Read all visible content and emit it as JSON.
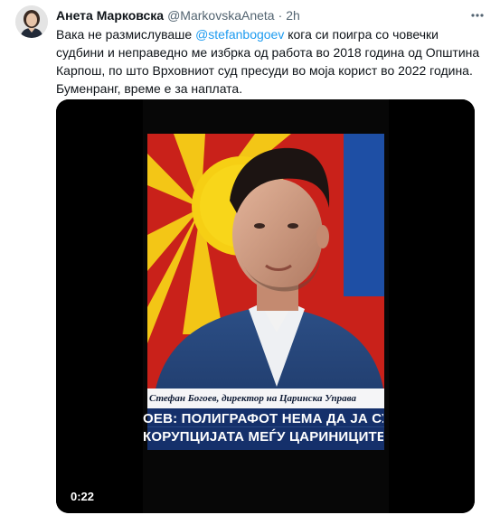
{
  "author": {
    "display_name": "Анета Марковска",
    "handle": "@MarkovskaAneta",
    "separator": "·",
    "time": "2h"
  },
  "tweet": {
    "text_prefix": "Вака не размислуваше ",
    "mention": "@stefanbogoev",
    "text_suffix": " кога си поигра со човечки судбини и неправедно ме избрка од работа во 2018 година од Општина Карпош, по што Врховниот суд пресуди во моја корист во 2022 година.\nБуменранг, време е за наплата."
  },
  "video": {
    "duration": "0:22",
    "caption_name": "Стефан Богоев, директор на Царинска Управа",
    "ticker_line_1": "ОЕВ: ПОЛИГРАФОТ НЕМА ДА ЈА СУЗБ",
    "ticker_line_2": "КОРУПЦИЈАТА МЕЃУ ЦАРИНИЦИТЕ"
  },
  "icons": {
    "more": "more-horizontal-icon"
  },
  "colors": {
    "link": "#1d9bf0",
    "secondary_text": "#536471",
    "flag_red": "#d52b1e",
    "flag_yellow": "#f8d211",
    "ticker_blue": "#15306b"
  }
}
